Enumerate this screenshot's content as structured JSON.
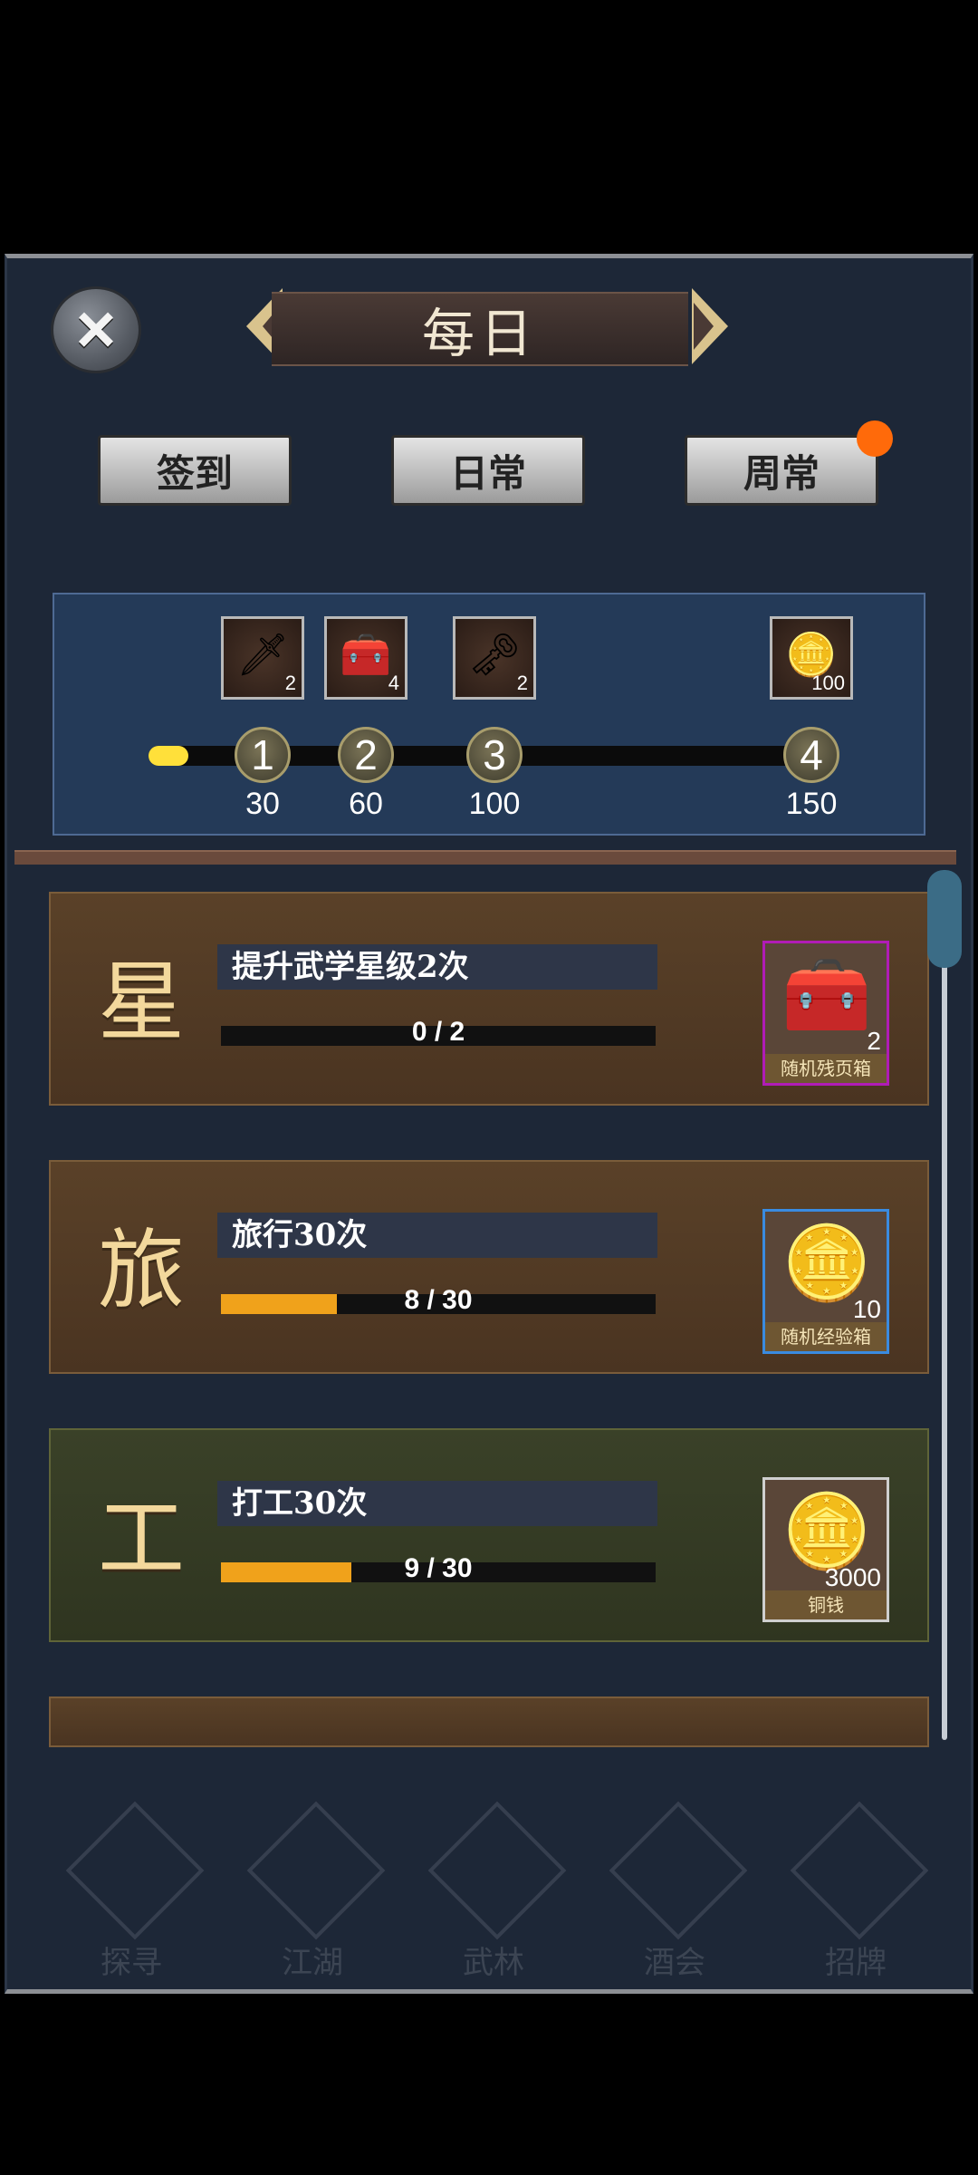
{
  "header": {
    "title": "每日",
    "close_icon": "×"
  },
  "tabs": [
    {
      "label": "签到"
    },
    {
      "label": "日常"
    },
    {
      "label": "周常"
    }
  ],
  "milestones": {
    "progress_points": 8,
    "max_points": 150,
    "rewards": [
      {
        "icon": "staff-icon",
        "glyph": "🗡",
        "count": "2"
      },
      {
        "icon": "chest-icon",
        "glyph": "🧰",
        "count": "4"
      },
      {
        "icon": "key-icon",
        "glyph": "🗝",
        "count": "2"
      },
      {
        "icon": "gold-ingot-icon",
        "glyph": "🪙",
        "count": "100"
      }
    ],
    "nodes": [
      {
        "num": "1",
        "value": "30"
      },
      {
        "num": "2",
        "value": "60"
      },
      {
        "num": "3",
        "value": "100"
      },
      {
        "num": "4",
        "value": "150"
      }
    ]
  },
  "tasks": [
    {
      "char": "星",
      "title": "提升武学星级2次",
      "progress_text": "0 / 2",
      "progress": 0.0,
      "reward": {
        "icon": "gold-chest-icon",
        "glyph": "🧰",
        "count": "2",
        "label": "随机残页箱"
      }
    },
    {
      "char": "旅",
      "title": "旅行30次",
      "progress_text": "8 / 30",
      "progress": 0.267,
      "reward": {
        "icon": "jade-chest-icon",
        "glyph": "🪙",
        "count": "10",
        "label": "随机经验箱"
      }
    },
    {
      "char": "工",
      "title": "打工30次",
      "progress_text": "9 / 30",
      "progress": 0.3,
      "reward": {
        "icon": "copper-coins-icon",
        "glyph": "🪙",
        "count": "3000",
        "label": "铜钱"
      }
    }
  ],
  "bottom_nav": [
    {
      "label": "探寻"
    },
    {
      "label": "江湖"
    },
    {
      "label": "武林"
    },
    {
      "label": "酒会"
    },
    {
      "label": "招牌"
    }
  ],
  "colors": {
    "panel": "#1d2737",
    "accent_yellow": "#ffe03a",
    "progress_orange": "#f0a21b",
    "notify": "#ff6a0a"
  }
}
